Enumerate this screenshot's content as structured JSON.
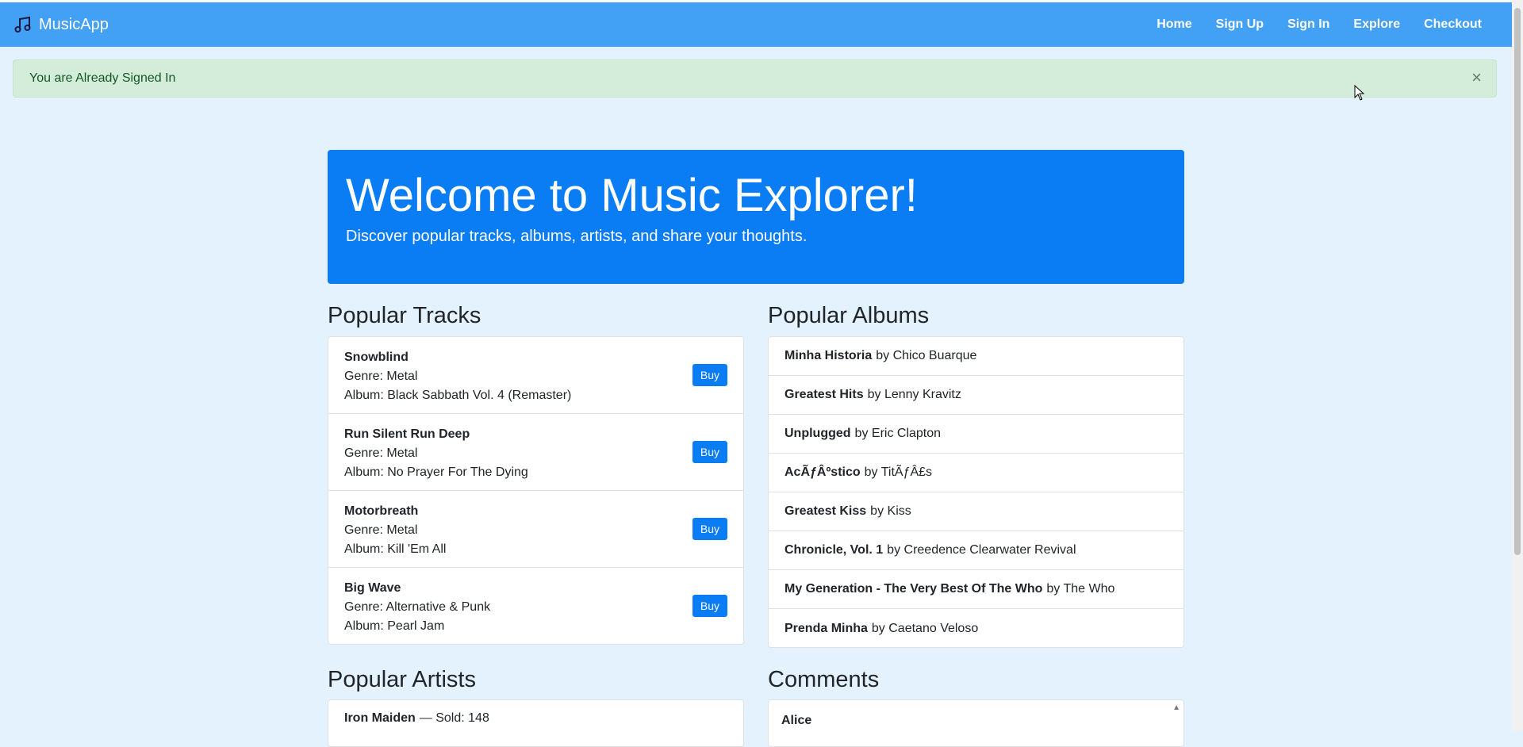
{
  "nav": {
    "brand": "MusicApp",
    "links": [
      "Home",
      "Sign Up",
      "Sign In",
      "Explore",
      "Checkout"
    ]
  },
  "alert": {
    "message": "You are Already Signed In",
    "close": "×"
  },
  "hero": {
    "title": "Welcome to Music Explorer!",
    "subtitle": "Discover popular tracks, albums, artists, and share your thoughts."
  },
  "tracks": {
    "heading": "Popular Tracks",
    "buy_label": "Buy",
    "items": [
      {
        "name": "Snowblind",
        "genre": "Genre: Metal",
        "album": "Album: Black Sabbath Vol. 4 (Remaster)"
      },
      {
        "name": "Run Silent Run Deep",
        "genre": "Genre: Metal",
        "album": "Album: No Prayer For The Dying"
      },
      {
        "name": "Motorbreath",
        "genre": "Genre: Metal",
        "album": "Album: Kill 'Em All"
      },
      {
        "name": "Big Wave",
        "genre": "Genre: Alternative & Punk",
        "album": "Album: Pearl Jam"
      }
    ]
  },
  "albums": {
    "heading": "Popular Albums",
    "items": [
      {
        "title": "Minha Historia",
        "by": "by Chico Buarque"
      },
      {
        "title": "Greatest Hits",
        "by": "by Lenny Kravitz"
      },
      {
        "title": "Unplugged",
        "by": "by Eric Clapton"
      },
      {
        "title": "AcÃƒÂºstico",
        "by": "by TitÃƒÂ£s"
      },
      {
        "title": "Greatest Kiss",
        "by": "by Kiss"
      },
      {
        "title": "Chronicle, Vol. 1",
        "by": "by Creedence Clearwater Revival"
      },
      {
        "title": "My Generation - The Very Best Of The Who",
        "by": "by The Who"
      },
      {
        "title": "Prenda Minha",
        "by": "by Caetano Veloso"
      }
    ]
  },
  "artists": {
    "heading": "Popular Artists",
    "items": [
      {
        "name": "Iron Maiden",
        "sold": "— Sold: 148"
      }
    ]
  },
  "comments": {
    "heading": "Comments",
    "items": [
      {
        "user": "Alice"
      }
    ]
  },
  "colors": {
    "navbar": "#42a0f5",
    "hero": "#0a7cf4",
    "page_bg": "#e3f2fd",
    "alert_bg": "#d4edda"
  }
}
